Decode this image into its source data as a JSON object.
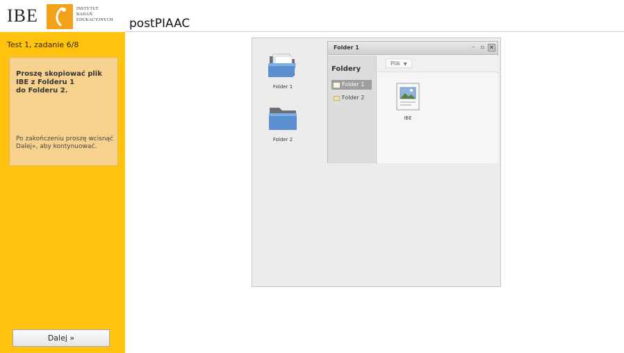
{
  "header": {
    "logo_text": "IBE",
    "institute_lines": [
      "INSTYTUT",
      "BADAŃ",
      "EDUKACYJNYCH"
    ],
    "app_title": "postPIAAC",
    "accent_color": "#f4a11a"
  },
  "sidebar": {
    "task_label": "Test 1, zadanie 6/8",
    "instruction_main": "Proszę skopiować plik\nIBE z Folderu 1\ndo Folderu 2.",
    "instruction_sub": "Po zakończeniu proszę wcisnąć Dalej», aby kontynuować.",
    "next_button": "Dalej »",
    "background_color": "#ffc20e"
  },
  "desktop": {
    "icons": [
      {
        "label": "Folder 1",
        "icon": "folder-open-icon"
      },
      {
        "label": "Folder 2",
        "icon": "folder-icon"
      }
    ]
  },
  "window": {
    "title": "Folder 1",
    "controls": {
      "minimize": "–",
      "restore": "▫",
      "close": "✕"
    },
    "sidebar_title": "Foldery",
    "folders": [
      {
        "label": "Folder 1",
        "selected": true
      },
      {
        "label": "Folder 2",
        "selected": false
      }
    ],
    "menu_label": "Plik",
    "files": [
      {
        "label": "IBE",
        "icon": "image-file-icon"
      }
    ]
  }
}
